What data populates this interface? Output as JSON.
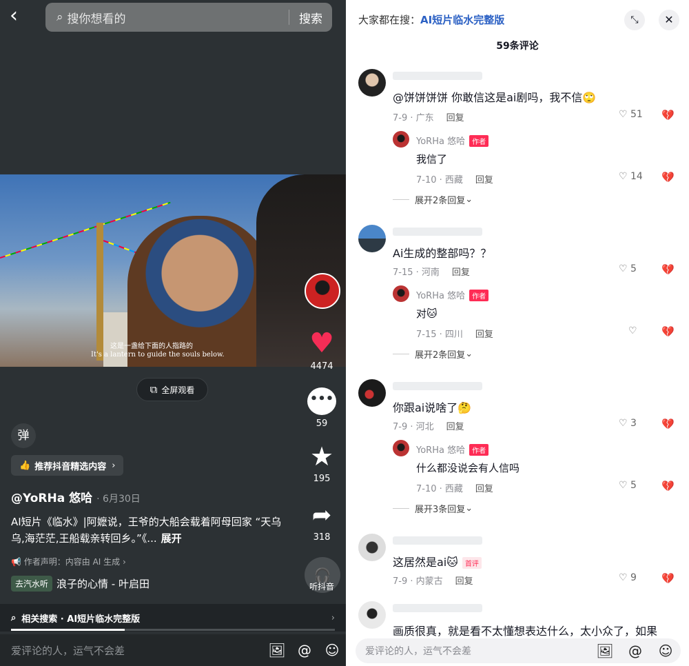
{
  "left": {
    "search_placeholder": "搜你想看的",
    "search_button": "搜索",
    "video_subtitle_cn": "这是一盏给下面的人指路的",
    "video_subtitle_en": "It's a lantern to guide the souls below.",
    "fullscreen_label": "全屏观看",
    "like_count": "4474",
    "comment_count": "59",
    "favorite_count": "195",
    "share_count": "318",
    "danmu_label": "弹",
    "recommend_label": "推荐抖音精选内容",
    "author": "@YoRHa 悠哈",
    "date": "· 6月30日",
    "description": "AI短片《临水》|阿嬷说，王爷的大船会载着阿母回家 “天乌乌,海茫茫,王船载亲转回乡。”《...",
    "expand_label": "展开",
    "declaration": "作者声明：内容由 AI 生成",
    "music_tag": "去汽水听",
    "music_title": "浪子的心情 - 叶启田",
    "listen_label": "听抖音",
    "related_search": "相关搜索 · AI短片临水完整版",
    "progress": 0.35,
    "comment_placeholder": "爱评论的人，运气不会差"
  },
  "right": {
    "header_prefix": "大家都在搜：",
    "header_keyword": "AI短片临水完整版",
    "comment_count_title": "59条评论",
    "comments": [
      {
        "text": "@饼饼饼饼 你敢信这是ai剧吗，我不信🙄",
        "date_loc": "7-9 · 广东",
        "reply": "回复",
        "likes": "51",
        "replies": [
          {
            "name": "YoRHa 悠哈",
            "tag": "作者",
            "text": "我信了",
            "date_loc": "7-10 · 西藏",
            "reply": "回复",
            "likes": "14"
          }
        ],
        "expand": "展开2条回复"
      },
      {
        "text": "Ai生成的整部吗？？",
        "date_loc": "7-15 · 河南",
        "reply": "回复",
        "likes": "5",
        "replies": [
          {
            "name": "YoRHa 悠哈",
            "tag": "作者",
            "text": "对🐱",
            "date_loc": "7-15 · 四川",
            "reply": "回复",
            "likes": ""
          }
        ],
        "expand": "展开2条回复"
      },
      {
        "text": "你跟ai说啥了🤔",
        "date_loc": "7-9 · 河北",
        "reply": "回复",
        "likes": "3",
        "replies": [
          {
            "name": "YoRHa 悠哈",
            "tag": "作者",
            "text": "什么都没说会有人信吗",
            "date_loc": "7-10 · 西藏",
            "reply": "回复",
            "likes": "5"
          }
        ],
        "expand": "展开3条回复"
      },
      {
        "text": "这居然是ai🐱",
        "first_tag": "首评",
        "date_loc": "7-9 · 内蒙古",
        "reply": "回复",
        "likes": "9"
      },
      {
        "text": "画质很真，就是看不太懂想表达什么，太小众了，如果"
      }
    ],
    "comment_placeholder": "爱评论的人，运气不会差"
  }
}
